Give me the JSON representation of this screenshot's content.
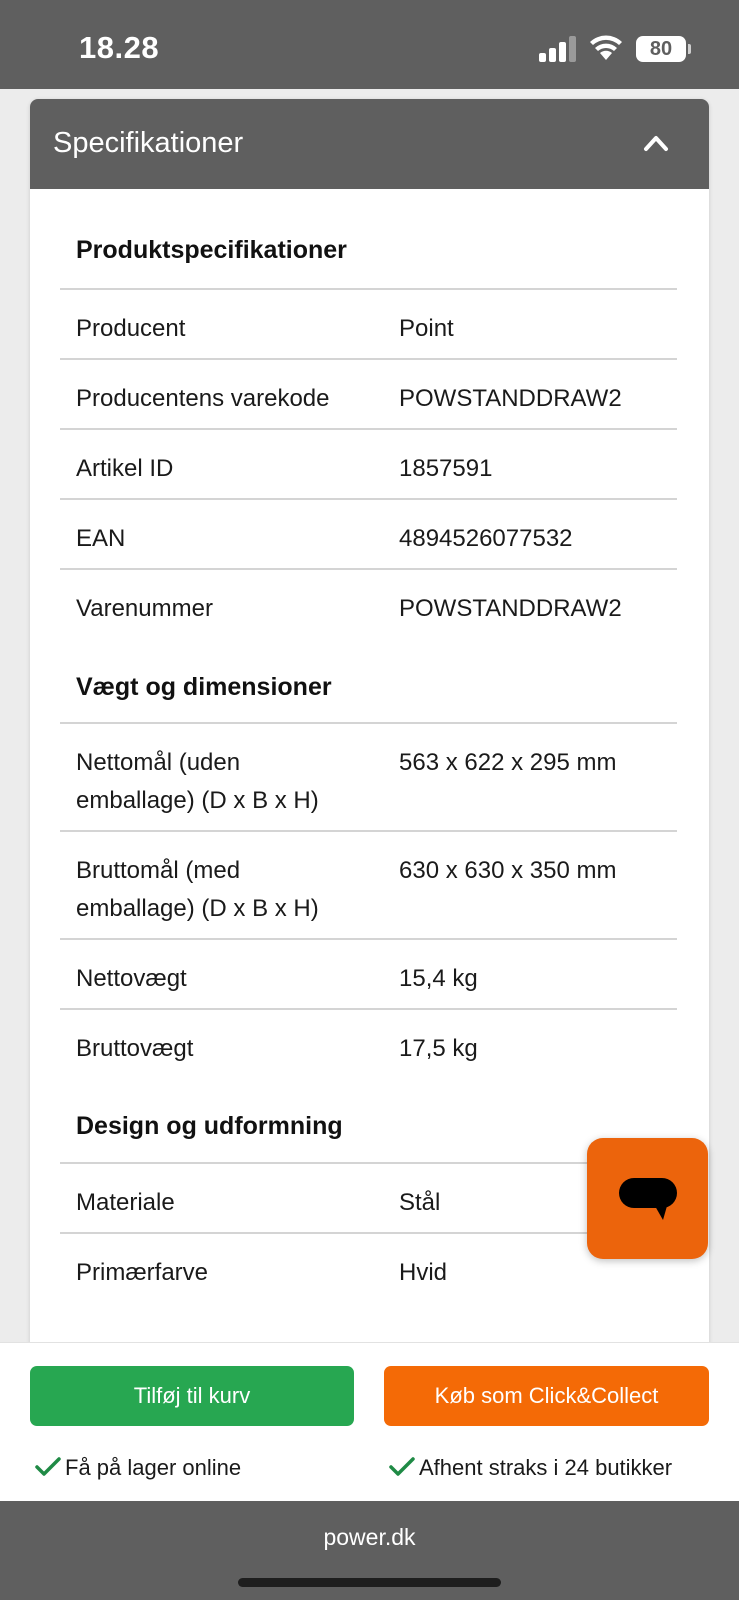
{
  "status_bar": {
    "time": "18.28",
    "battery": "80"
  },
  "header": {
    "title": "Specifikationer",
    "collapse_icon": "chevron-up-icon"
  },
  "sections": [
    {
      "heading": "Produktspecifikationer",
      "rows": [
        {
          "label": "Producent",
          "value": "Point"
        },
        {
          "label": "Producentens varekode",
          "value": "POWSTANDDRAW2"
        },
        {
          "label": "Artikel ID",
          "value": "1857591"
        },
        {
          "label": "EAN",
          "value": "4894526077532"
        },
        {
          "label": "Varenummer",
          "value": "POWSTANDDRAW2"
        }
      ]
    },
    {
      "heading": "Vægt og dimensioner",
      "rows": [
        {
          "label": "Nettomål (uden emballage) (D x B x H)",
          "value": "563 x 622 x 295 mm"
        },
        {
          "label": "Bruttomål (med emballage) (D x B x H)",
          "value": "630 x 630 x 350 mm"
        },
        {
          "label": "Nettovægt",
          "value": "15,4 kg"
        },
        {
          "label": "Bruttovægt",
          "value": "17,5 kg"
        }
      ]
    },
    {
      "heading": "Design og udformning",
      "rows": [
        {
          "label": "Materiale",
          "value": "Stål"
        },
        {
          "label": "Primærfarve",
          "value": "Hvid"
        }
      ]
    }
  ],
  "chat": {
    "icon": "chat-bubble-icon",
    "color": "#ec640c"
  },
  "actions": {
    "add_to_cart": "Tilføj til kurv",
    "click_collect": "Køb som Click&Collect",
    "online_stock": "Få på lager online",
    "store_pickup": "Afhent straks i 24 butikker"
  },
  "colors": {
    "green": "#27a751",
    "orange": "#f46a06",
    "header_gray": "#5f5f5f"
  },
  "browser": {
    "url": "power.dk"
  }
}
